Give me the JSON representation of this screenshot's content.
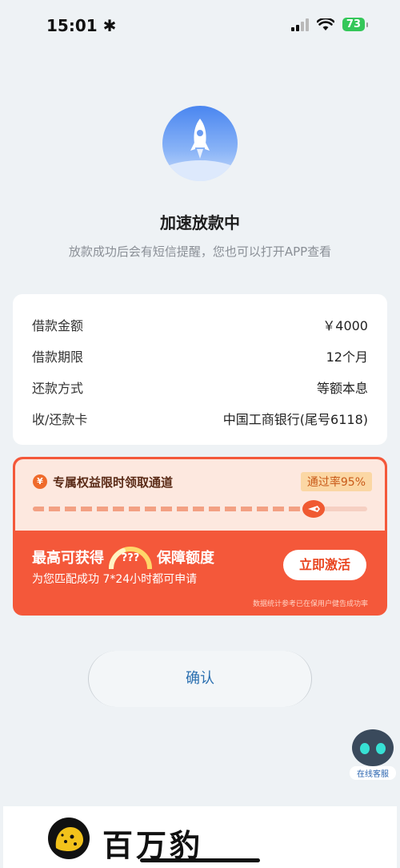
{
  "status_bar": {
    "time": "15:01",
    "time_icon": "asterisk-icon",
    "battery": "73"
  },
  "hero": {
    "icon": "rocket-icon",
    "title": "加速放款中",
    "subtitle": "放款成功后会有短信提醒，您也可以打开APP查看"
  },
  "loan_info": {
    "rows": [
      {
        "label": "借款金额",
        "value": "￥4000"
      },
      {
        "label": "借款期限",
        "value": "12个月"
      },
      {
        "label": "还款方式",
        "value": "等额本息"
      },
      {
        "label": "收/还款卡",
        "value": "中国工商银行(尾号6118)"
      }
    ]
  },
  "promo": {
    "icon": "yen-icon",
    "icon_glyph": "¥",
    "title": "专属权益限时领取通道",
    "rate_badge": "通过率95%",
    "progress": 0.84,
    "main_prefix": "最高可获得",
    "gauge_text": "???",
    "main_suffix": "保障额度",
    "subtitle": "为您匹配成功  7*24小时都可申请",
    "button": "立即激活",
    "note": "数据统计参考已在保用户健告成功率",
    "colors": {
      "accent": "#f4583a",
      "light": "#fde8df"
    }
  },
  "confirm_button": "确认",
  "customer_service": {
    "label": "在线客服",
    "icon": "robot-icon"
  },
  "brand": {
    "name": "百万豹",
    "logo": "leopard-logo"
  }
}
